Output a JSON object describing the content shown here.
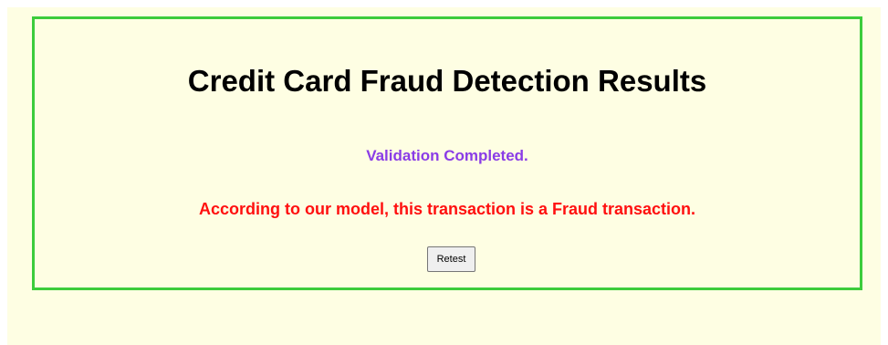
{
  "result": {
    "title": "Credit Card Fraud Detection Results",
    "status_message": "Validation Completed.",
    "verdict_message": "According to our model, this transaction is a Fraud transaction.",
    "retest_label": "Retest"
  },
  "colors": {
    "page_background": "#fefee3",
    "box_border": "#3ccc3c",
    "status_text": "#8a3ce6",
    "verdict_text": "#ff0f0f"
  }
}
